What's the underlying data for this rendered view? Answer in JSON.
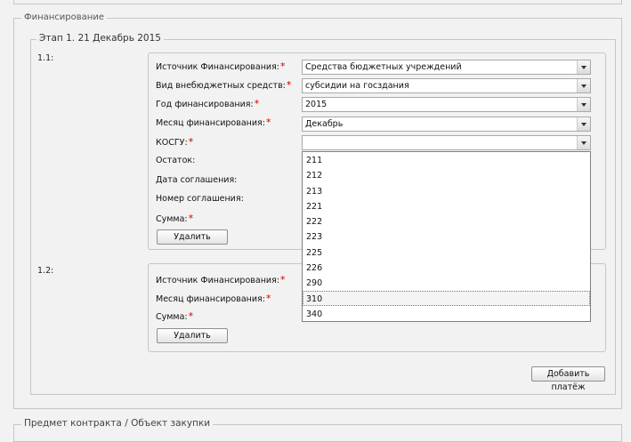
{
  "section": {
    "legend": "Финансирование"
  },
  "stage": {
    "legend": "Этап 1. 21 Декабрь 2015"
  },
  "payment1": {
    "label": "1.1:",
    "fields": {
      "source": {
        "label": "Источник Финансирования:",
        "value": "Средства бюджетных учреждений"
      },
      "extra_type": {
        "label": "Вид внебюджетных средств:",
        "value": "субсидии на госздания"
      },
      "year": {
        "label": "Год финансирования:",
        "value": "2015"
      },
      "month": {
        "label": "Месяц финансирования:",
        "value": "Декабрь"
      },
      "kosgu": {
        "label": "КОСГУ:",
        "value": ""
      },
      "remainder": {
        "label": "Остаток:"
      },
      "agreement_date": {
        "label": "Дата соглашения:"
      },
      "agreement_number": {
        "label": "Номер соглашения:"
      },
      "amount": {
        "label": "Сумма:"
      }
    },
    "delete_label": "Удалить"
  },
  "payment2": {
    "label": "1.2:",
    "fields": {
      "source": {
        "label": "Источник Финансирования:"
      },
      "month": {
        "label": "Месяц финансирования:"
      },
      "amount": {
        "label": "Сумма:"
      }
    },
    "delete_label": "Удалить"
  },
  "required_mark": "*",
  "kosgu_dropdown": {
    "options": [
      "211",
      "212",
      "213",
      "221",
      "222",
      "223",
      "225",
      "226",
      "290",
      "310",
      "340"
    ],
    "highlighted": "310"
  },
  "add_payment_label": "Добавить платёж",
  "next_section": {
    "legend": "Предмет контракта / Объект закупки"
  },
  "colors": {
    "required": "#cc0000",
    "background": "#f2f2f2",
    "border": "#c6c6c6"
  }
}
